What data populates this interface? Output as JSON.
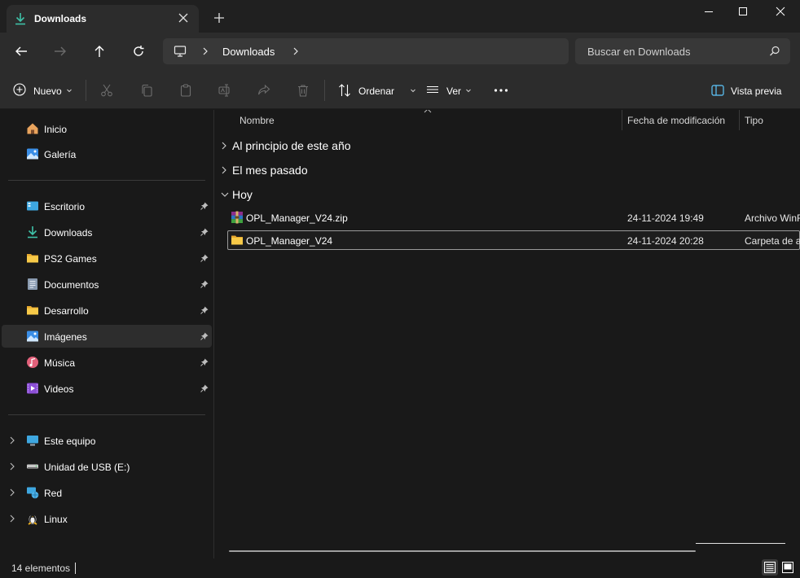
{
  "window": {
    "tab_title": "Downloads",
    "tab_icon": "download-icon"
  },
  "navbar": {
    "address_crumb": "Downloads",
    "search_placeholder": "Buscar en Downloads"
  },
  "toolbar": {
    "new_label": "Nuevo",
    "sort_label": "Ordenar",
    "view_label": "Ver",
    "preview_label": "Vista previa",
    "disabled_icons": [
      "cut-icon",
      "copy-icon",
      "paste-icon",
      "rename-icon",
      "share-icon",
      "delete-icon"
    ]
  },
  "sidebar": {
    "top_items": [
      {
        "label": "Inicio",
        "icon": "home-icon"
      },
      {
        "label": "Galería",
        "icon": "gallery-icon"
      }
    ],
    "pinned_items": [
      {
        "label": "Escritorio",
        "icon": "desktop-icon"
      },
      {
        "label": "Downloads",
        "icon": "download-icon"
      },
      {
        "label": "PS2 Games",
        "icon": "folder-icon"
      },
      {
        "label": "Documentos",
        "icon": "documents-icon"
      },
      {
        "label": "Desarrollo",
        "icon": "folder-icon"
      },
      {
        "label": "Imágenes",
        "icon": "pictures-icon",
        "selected": true
      },
      {
        "label": "Música",
        "icon": "music-icon"
      },
      {
        "label": "Videos",
        "icon": "videos-icon"
      }
    ],
    "device_items": [
      {
        "label": "Este equipo",
        "icon": "computer-icon"
      },
      {
        "label": "Unidad de USB (E:)",
        "icon": "usb-drive-icon"
      },
      {
        "label": "Red",
        "icon": "network-icon"
      },
      {
        "label": "Linux",
        "icon": "linux-icon"
      }
    ]
  },
  "file_list": {
    "columns": [
      "Nombre",
      "Fecha de modificación",
      "Tipo"
    ],
    "groups": [
      {
        "label": "Al principio de este año",
        "expanded": false
      },
      {
        "label": "El mes pasado",
        "expanded": false
      },
      {
        "label": "Hoy",
        "expanded": true
      }
    ],
    "files": [
      {
        "name": "OPL_Manager_V24.zip",
        "date": "24-11-2024 19:49",
        "type": "Archivo WinR",
        "icon": "winrar-archive-icon"
      },
      {
        "name": "OPL_Manager_V24",
        "date": "24-11-2024 20:28",
        "type": "Carpeta de a",
        "icon": "folder-icon",
        "focused": true
      }
    ]
  },
  "status": {
    "item_count": "14 elementos"
  },
  "colors": {
    "accent": "#3fc2a8",
    "folder": "#f5c54a",
    "background": "#191919",
    "chrome": "#2c2c2c"
  }
}
